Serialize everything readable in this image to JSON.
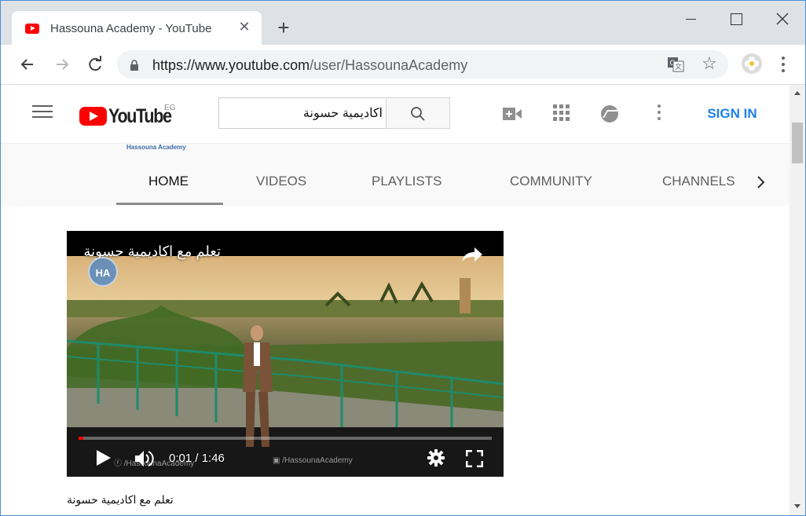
{
  "browser": {
    "tab_title": "Hassouna Academy - YouTube",
    "url_host": "https://www.youtube.com",
    "url_path": "/user/HassounaAcademy"
  },
  "youtube": {
    "country_code": "EG",
    "search_query": "اكاديمية حسونة",
    "sign_in_label": "SIGN IN"
  },
  "channel": {
    "logo_text": "Hassouna Academy",
    "tabs": [
      {
        "label": "HOME",
        "active": true
      },
      {
        "label": "VIDEOS",
        "active": false
      },
      {
        "label": "PLAYLISTS",
        "active": false
      },
      {
        "label": "COMMUNITY",
        "active": false
      },
      {
        "label": "CHANNELS",
        "active": false
      }
    ]
  },
  "video": {
    "title": "تعلم مع اكاديمية حسونة",
    "time": "0:01 / 1:46",
    "progress": 0.01,
    "badge_text": "HA",
    "watermark_facebook": "/HassounaAcademy",
    "watermark_youtube": "/HassounaAcademy",
    "caption": "تعلم مع اكاديمية حسونة"
  },
  "colors": {
    "youtube_red": "#ff0000",
    "sign_in_blue": "#1e82e6",
    "tab_strip": "#dee1e6",
    "window_border": "#4a8fd6"
  }
}
